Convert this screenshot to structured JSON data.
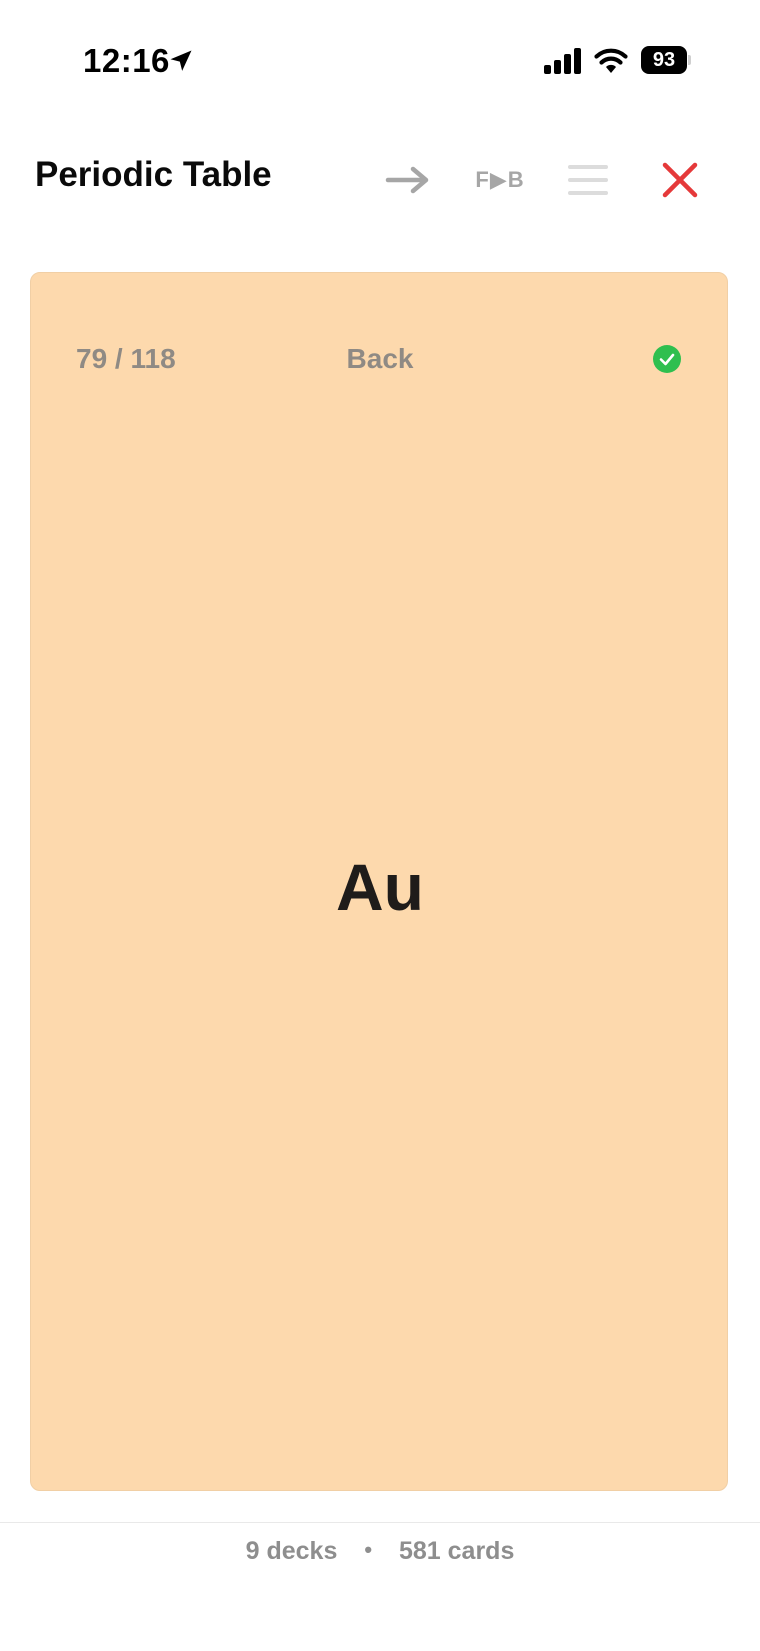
{
  "status_bar": {
    "time": "12:16",
    "battery": "93"
  },
  "header": {
    "title": "Periodic Table",
    "direction_label": "F▶B",
    "icons": {
      "next": "arrow-right-icon",
      "menu": "menu-icon",
      "close": "close-icon"
    }
  },
  "card": {
    "counter": "79 / 118",
    "side": "Back",
    "content": "Au",
    "status_icon": "check-circle-icon"
  },
  "footer": {
    "decks": "9 decks",
    "separator": "•",
    "cards": "581 cards"
  },
  "colors": {
    "card_background": "#fdd9ad",
    "close": "#e5393a",
    "check": "#2fbf4f",
    "muted": "#a6a6a6"
  }
}
